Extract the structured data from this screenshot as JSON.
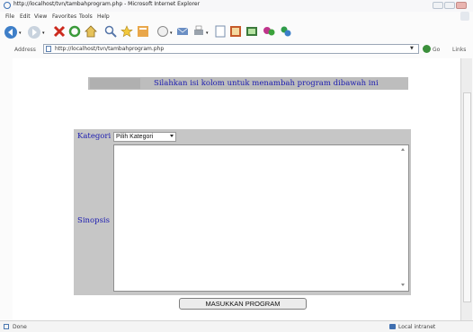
{
  "window": {
    "title": "http://localhost/tvn/tambahprogram.php - Microsoft Internet Explorer"
  },
  "menu": {
    "items": [
      "File",
      "Edit",
      "View",
      "Favorites",
      "Tools",
      "Help"
    ]
  },
  "toolbar": {
    "icons": [
      "back-icon",
      "forward-icon",
      "stop-icon",
      "refresh-icon",
      "home-icon",
      "search-icon",
      "favorites-icon",
      "history-icon",
      "media-icon",
      "mail-icon",
      "print-icon",
      "edit-icon",
      "discuss-icon",
      "messenger-icon",
      "research-icon",
      "extra-icon"
    ]
  },
  "address": {
    "label": "Address",
    "url": "http://localhost/tvn/tambahprogram.php",
    "go_label": "Go",
    "links_label": "Links"
  },
  "page": {
    "instruction": "Silahkan isi kolom untuk menambah program dibawah ini",
    "kategori_label": "Kategori",
    "kategori_value": "Pilih Kategori",
    "sinopsis_label": "Sinopsis",
    "sinopsis_value": "",
    "submit_label": "MASUKKAN PROGRAM"
  },
  "status": {
    "text": "Done",
    "zone": "Local intranet"
  },
  "colors": {
    "label_text": "#1b1bb0",
    "table_bg": "#c6c6c6",
    "header_bg": "#bdbdbd"
  }
}
